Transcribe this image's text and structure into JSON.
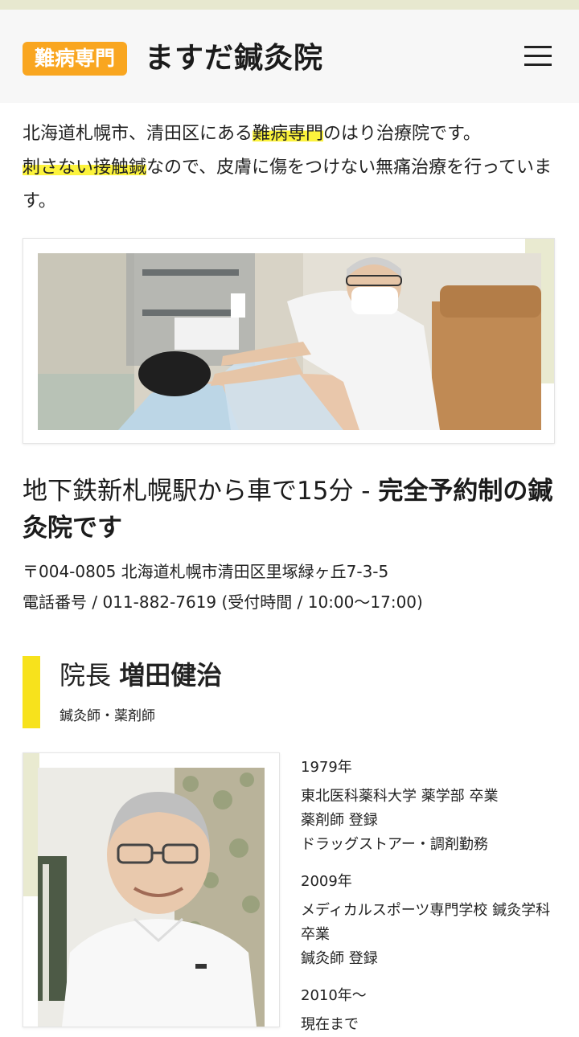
{
  "header": {
    "badge": "難病専門",
    "title": "ますだ鍼灸院",
    "menu_icon": "hamburger-menu-icon"
  },
  "intro": {
    "line1_a": "北海道札幌市、清田区にある",
    "line1_hl": "難病専門",
    "line1_b": "のはり治療院です。",
    "line2_hl": "刺さない接触鍼",
    "line2_b": "なので、皮膚に傷をつけない無痛治療を行っています。"
  },
  "access": {
    "title_a": "地下鉄新札幌駅から車で15分 - ",
    "title_b": "完全予約制の鍼灸院です",
    "address": "〒004-0805 北海道札幌市清田区里塚緑ヶ丘7-3-5",
    "phone": "電話番号 / 011-882-7619 (受付時間 / 10:00～17:00)"
  },
  "director": {
    "role": "院長",
    "name": "増田健治",
    "quals": "鍼灸師・薬剤師"
  },
  "timeline": [
    {
      "year": "1979年",
      "lines": [
        "東北医科薬科大学 薬学部 卒業",
        "薬剤師 登録",
        "ドラッグストアー・調剤勤務"
      ]
    },
    {
      "year": "2009年",
      "lines": [
        "メディカルスポーツ専門学校 鍼灸学科 卒業",
        "鍼灸師 登録"
      ]
    },
    {
      "year": "2010年～",
      "lines": [
        "現在まで"
      ]
    }
  ],
  "colors": {
    "badge": "#f9a620",
    "highlight": "#fcf33c",
    "accent_bar": "#f7e21c",
    "frame_accent": "#e9ead0"
  }
}
